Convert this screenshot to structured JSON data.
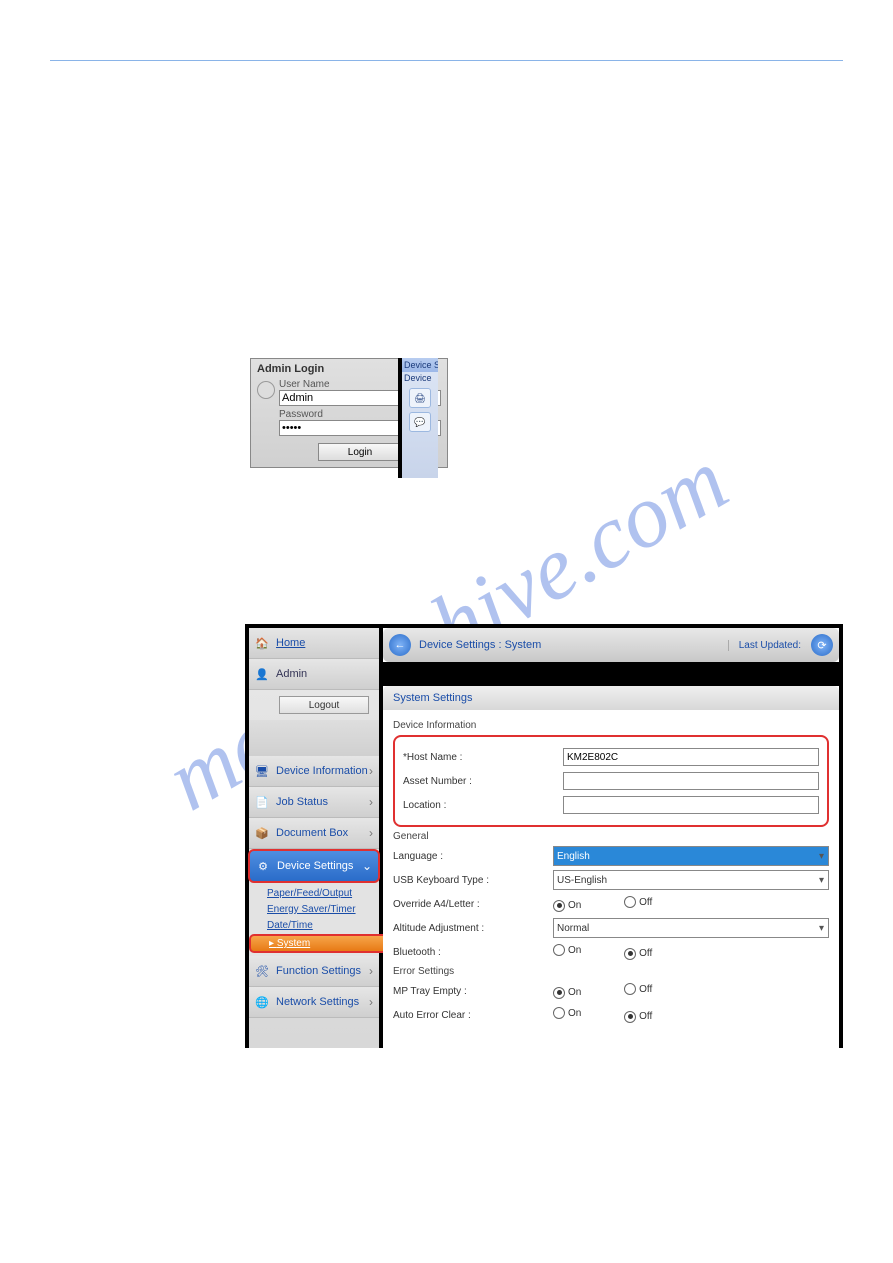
{
  "watermark": "manualshive.com",
  "login": {
    "title": "Admin Login",
    "user_label": "User Name",
    "user_value": "Admin",
    "pass_label": "Password",
    "pass_value": "•••••",
    "button": "Login"
  },
  "device_snippet": {
    "header": "Device S",
    "sub": "Device"
  },
  "sidebar": {
    "home": "Home",
    "admin": "Admin",
    "logout": "Logout",
    "items": [
      {
        "label": "Device Information"
      },
      {
        "label": "Job Status"
      },
      {
        "label": "Document Box"
      },
      {
        "label": "Device Settings"
      },
      {
        "label": "Function Settings"
      },
      {
        "label": "Network Settings"
      }
    ],
    "sublinks": {
      "a": "Paper/Feed/Output",
      "b": "Energy Saver/Timer",
      "c": "Date/Time",
      "d": "System"
    }
  },
  "crumb": {
    "path": "Device Settings : System",
    "last_updated_label": "Last Updated:"
  },
  "panel": {
    "header": "System Settings",
    "device_info_section": "Device Information",
    "host_name_label": "*Host Name :",
    "host_name_value": "KM2E802C",
    "asset_label": "Asset Number :",
    "asset_value": "",
    "location_label": "Location :",
    "location_value": "",
    "general_section": "General",
    "language_label": "Language :",
    "language_value": "English",
    "usb_kb_label": "USB Keyboard Type :",
    "usb_kb_value": "US-English",
    "override_label": "Override A4/Letter :",
    "altitude_label": "Altitude Adjustment :",
    "altitude_value": "Normal",
    "bluetooth_label": "Bluetooth :",
    "error_section": "Error Settings",
    "mp_tray_label": "MP Tray Empty :",
    "auto_err_label": "Auto Error Clear :",
    "on": "On",
    "off": "Off"
  }
}
